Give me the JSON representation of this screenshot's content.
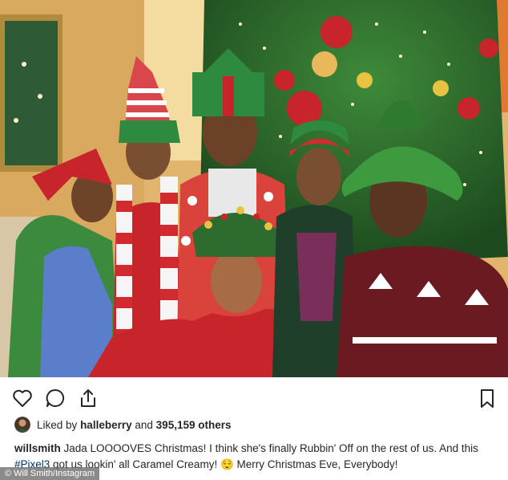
{
  "post": {
    "photo_alt": "",
    "liked_prefix": "Liked by ",
    "liked_user": "halleberry",
    "liked_and": " and ",
    "liked_count": "395,159 others",
    "caption_user": "willsmith",
    "caption_text_1": " Jada LOOOOVES Christmas!  I think she's finally Rubbin' Off on the rest of us. And this ",
    "caption_hashtag": "#Pixel3",
    "caption_text_2": " got us lookin' all Caramel Creamy! 😌  Merry Christmas Eve, Everybody!"
  },
  "actions": {
    "like_icon": "heart-icon",
    "comment_icon": "comment-icon",
    "share_icon": "share-icon",
    "save_icon": "bookmark-icon"
  },
  "credit": "© Will Smith/Instagram",
  "colors": {
    "hashtag": "#003569",
    "text": "#262626"
  }
}
